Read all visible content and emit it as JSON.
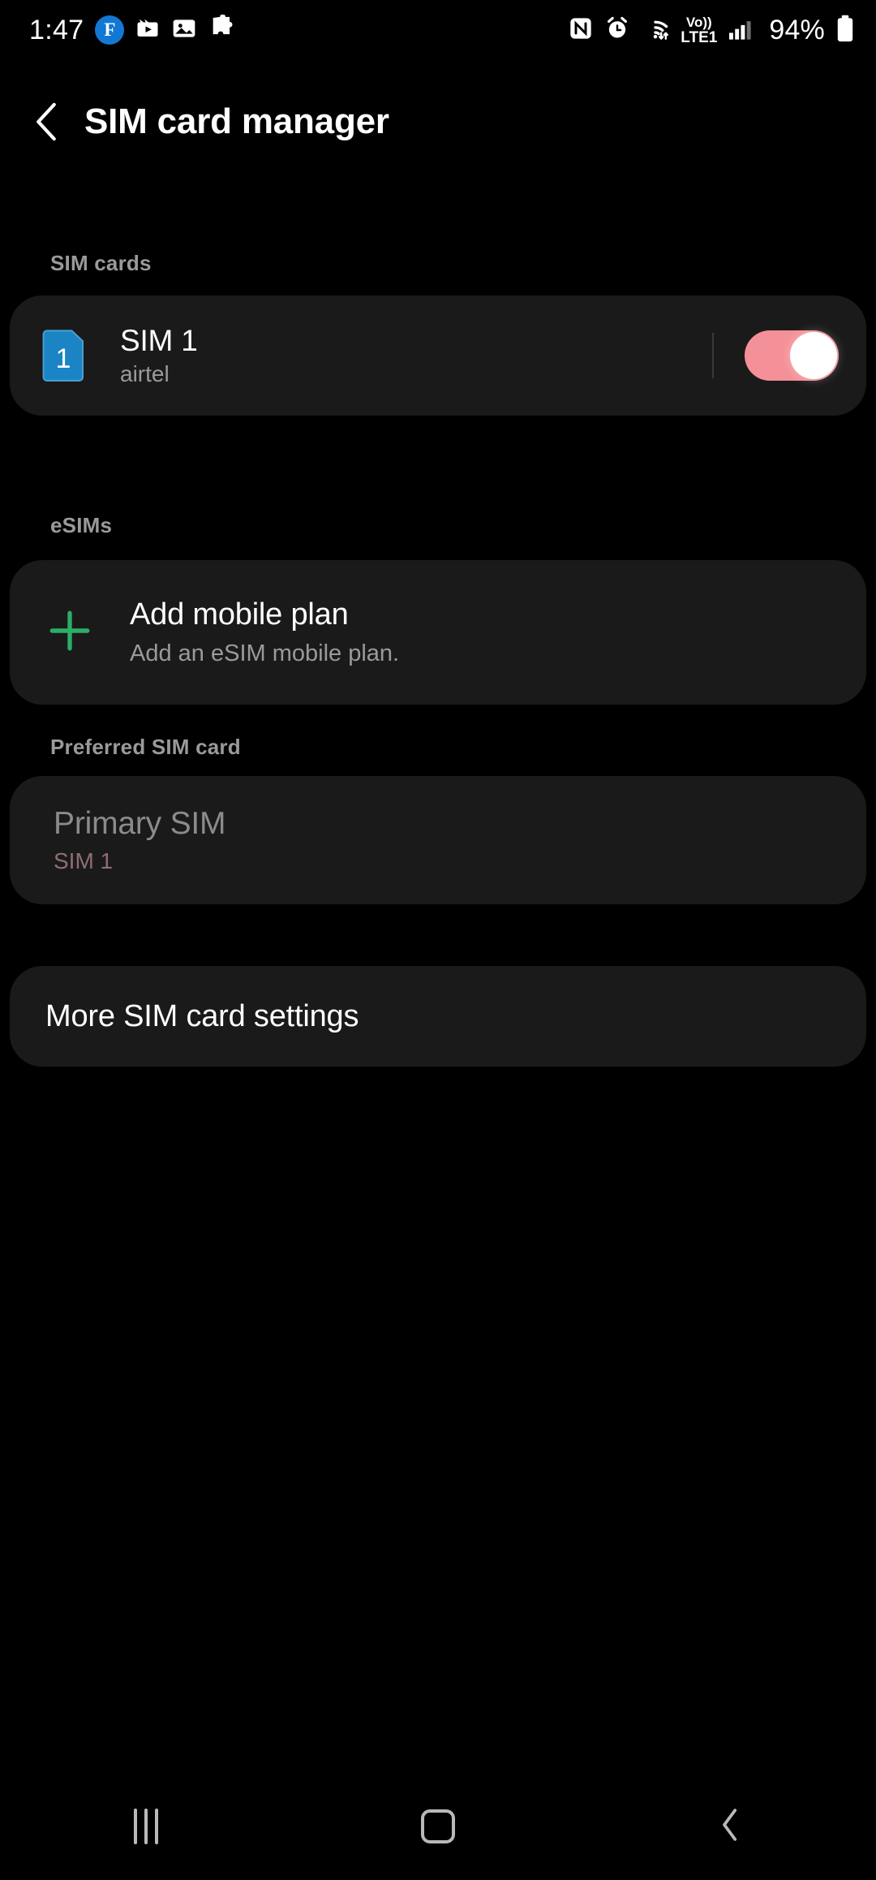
{
  "statusbar": {
    "clock": "1:47",
    "battery_percent": "94%",
    "network_label": "LTE1",
    "volte_label": "Vo))",
    "left_icons": [
      "facebook-badge-icon",
      "video-clip-icon",
      "photo-icon",
      "puzzle-piece-icon"
    ],
    "right_icons": [
      "nfc-icon",
      "alarm-icon",
      "wifi-icon",
      "volte-icon",
      "signal-bars-icon",
      "battery-icon"
    ]
  },
  "header": {
    "title": "SIM card manager",
    "back_icon": "back-chevron-icon"
  },
  "sections": {
    "sim_cards_label": "SIM cards",
    "esims_label": "eSIMs",
    "preferred_label": "Preferred SIM card"
  },
  "sim": {
    "badge_number": "1",
    "title": "SIM 1",
    "carrier": "airtel",
    "toggle_state": "on",
    "toggle_color": "#F49098",
    "badge_color": "#1B84C4"
  },
  "esim": {
    "title": "Add mobile plan",
    "subtitle": "Add an eSIM mobile plan.",
    "plus_icon": "plus-icon",
    "plus_color": "#2BAE66"
  },
  "preferred": {
    "title": "Primary SIM",
    "value": "SIM 1"
  },
  "more_settings": {
    "title": "More SIM card settings"
  },
  "navbar": {
    "recents_label": "recents-icon",
    "home_label": "home-icon",
    "back_label": "back-icon"
  }
}
